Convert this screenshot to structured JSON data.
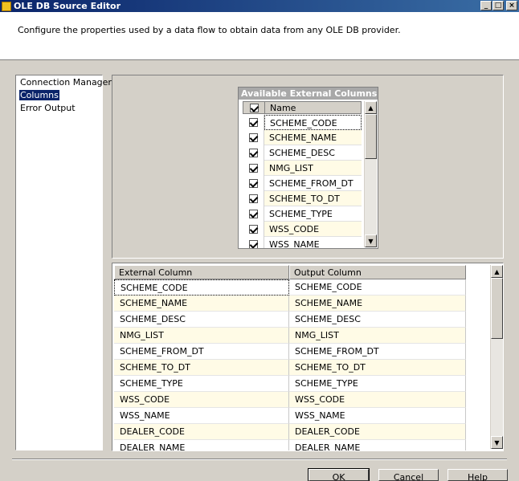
{
  "window": {
    "title": "OLE DB Source Editor",
    "controls": {
      "minimize": "_",
      "maximize": "□",
      "close": "×"
    }
  },
  "header": {
    "description": "Configure the properties used by a data flow to obtain data from any OLE DB provider."
  },
  "nav": {
    "items": [
      {
        "label": "Connection Manager",
        "selected": false
      },
      {
        "label": "Columns",
        "selected": true
      },
      {
        "label": "Error Output",
        "selected": false
      }
    ]
  },
  "available_columns": {
    "title": "Available External Columns",
    "header_name": "Name",
    "rows": [
      {
        "name": "SCHEME_CODE",
        "checked": true
      },
      {
        "name": "SCHEME_NAME",
        "checked": true
      },
      {
        "name": "SCHEME_DESC",
        "checked": true
      },
      {
        "name": "NMG_LIST",
        "checked": true
      },
      {
        "name": "SCHEME_FROM_DT",
        "checked": true
      },
      {
        "name": "SCHEME_TO_DT",
        "checked": true
      },
      {
        "name": "SCHEME_TYPE",
        "checked": true
      },
      {
        "name": "WSS_CODE",
        "checked": true
      },
      {
        "name": "WSS_NAME",
        "checked": true
      }
    ]
  },
  "mapping": {
    "headers": [
      "External Column",
      "Output Column"
    ],
    "rows": [
      [
        "SCHEME_CODE",
        "SCHEME_CODE"
      ],
      [
        "SCHEME_NAME",
        "SCHEME_NAME"
      ],
      [
        "SCHEME_DESC",
        "SCHEME_DESC"
      ],
      [
        "NMG_LIST",
        "NMG_LIST"
      ],
      [
        "SCHEME_FROM_DT",
        "SCHEME_FROM_DT"
      ],
      [
        "SCHEME_TO_DT",
        "SCHEME_TO_DT"
      ],
      [
        "SCHEME_TYPE",
        "SCHEME_TYPE"
      ],
      [
        "WSS_CODE",
        "WSS_CODE"
      ],
      [
        "WSS_NAME",
        "WSS_NAME"
      ],
      [
        "DEALER_CODE",
        "DEALER_CODE"
      ],
      [
        "DEALER_NAME",
        "DEALER_NAME"
      ]
    ]
  },
  "buttons": {
    "ok": "OK",
    "cancel": "Cancel",
    "help": "Help"
  },
  "icons": {
    "scroll_up": "▲",
    "scroll_down": "▼"
  }
}
